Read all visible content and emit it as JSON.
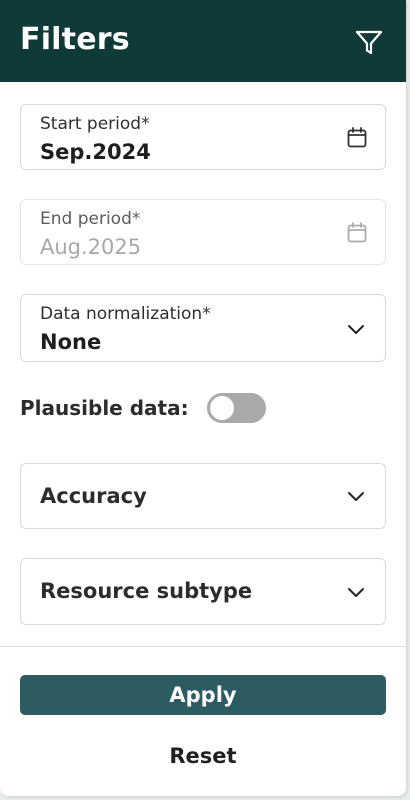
{
  "header": {
    "title": "Filters",
    "icon": "filter-icon",
    "background_color": "#0f3a38"
  },
  "fields": {
    "start_period": {
      "label": "Start period*",
      "value": "Sep.2024",
      "icon": "calendar-icon",
      "disabled": false
    },
    "end_period": {
      "label": "End period*",
      "value": "Aug.2025",
      "icon": "calendar-icon",
      "disabled": true
    },
    "data_normalization": {
      "label": "Data normalization*",
      "value": "None",
      "icon": "chevron-down-icon"
    }
  },
  "plausible_data": {
    "label": "Plausible data:",
    "enabled": false
  },
  "dropdowns": {
    "accuracy": {
      "label": "Accuracy",
      "icon": "chevron-down-icon"
    },
    "resource_subtype": {
      "label": "Resource subtype",
      "icon": "chevron-down-icon"
    }
  },
  "actions": {
    "apply_label": "Apply",
    "reset_label": "Reset",
    "apply_color": "#2c5b61"
  }
}
